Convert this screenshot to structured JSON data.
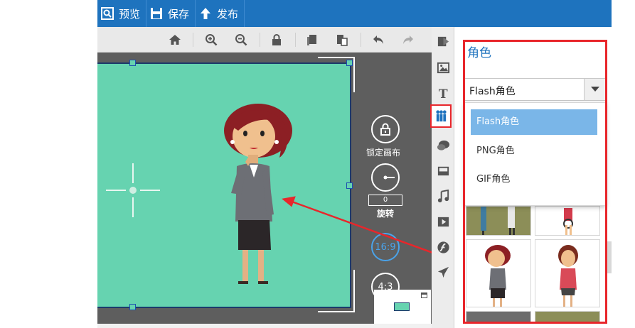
{
  "topbar": {
    "preview_label": "预览",
    "save_label": "保存",
    "publish_label": "发布",
    "color": "#1e73be"
  },
  "toolbar": {
    "icons": [
      "home-icon",
      "zoom-in-icon",
      "zoom-out-icon",
      "lock-icon",
      "copy-icon",
      "paste-icon",
      "undo-icon",
      "redo-icon"
    ]
  },
  "workarea": {
    "canvas_color": "#66d3b0",
    "lock_label": "锁定画布",
    "rotate_value": "0",
    "rotate_label": "旋转",
    "ratio_16_9": "16:9",
    "ratio_4_3": "4:3"
  },
  "iconstrip": {
    "icons": [
      "scene-icon",
      "image-icon",
      "text-icon",
      "characters-icon",
      "speech-bubble-icon",
      "inbox-icon",
      "music-icon",
      "video-icon",
      "swf-icon",
      "airplane-icon"
    ],
    "active": "characters-icon"
  },
  "panel": {
    "title": "角色",
    "select_value": "Flash角色",
    "options": [
      "Flash角色",
      "PNG角色",
      "GIF角色"
    ],
    "selected_option": "Flash角色"
  },
  "colors": {
    "accent": "#1e73be",
    "highlight_red": "#e8262b",
    "selected_option_bg": "#7ab6e8"
  }
}
